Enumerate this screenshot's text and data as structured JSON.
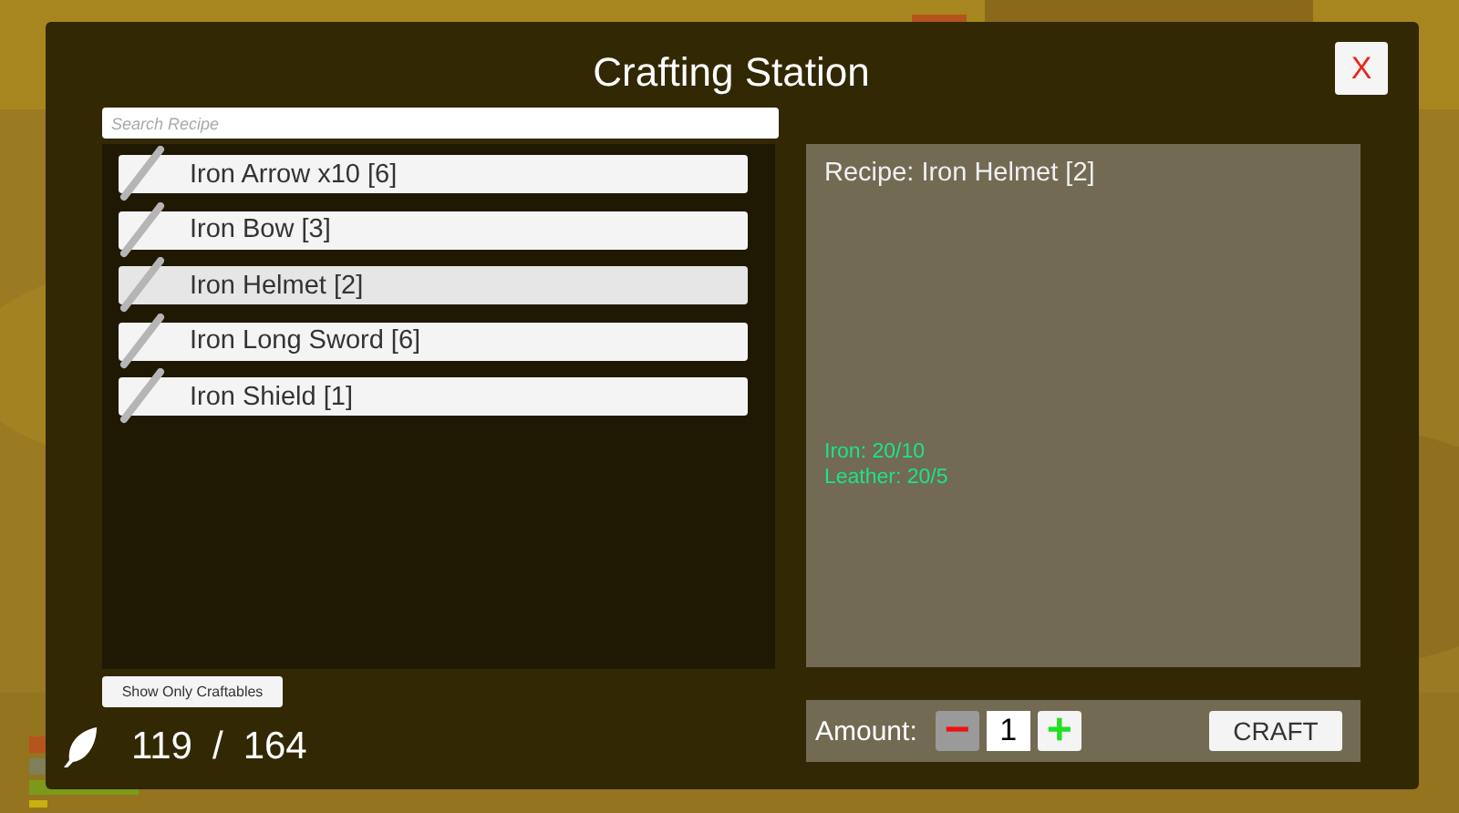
{
  "window": {
    "title": "Crafting Station",
    "close_label": "X"
  },
  "search": {
    "placeholder": "Search Recipe"
  },
  "recipes": [
    {
      "label": "Iron Arrow x10 [6]",
      "selected": false
    },
    {
      "label": "Iron Bow [3]",
      "selected": false
    },
    {
      "label": "Iron Helmet [2]",
      "selected": true
    },
    {
      "label": "Iron Long Sword [6]",
      "selected": false
    },
    {
      "label": "Iron Shield [1]",
      "selected": false
    }
  ],
  "filter_button": "Show Only Craftables",
  "recipe_panel": {
    "title": "Recipe: Iron Helmet [2]",
    "ingredients": [
      "Iron: 20/10",
      "Leather: 20/5"
    ]
  },
  "amount": {
    "label": "Amount:",
    "minus": "−",
    "value": "1",
    "plus": "+"
  },
  "craft_button": "CRAFT",
  "capacity": {
    "current": "119",
    "separator": "/",
    "total": "164"
  }
}
